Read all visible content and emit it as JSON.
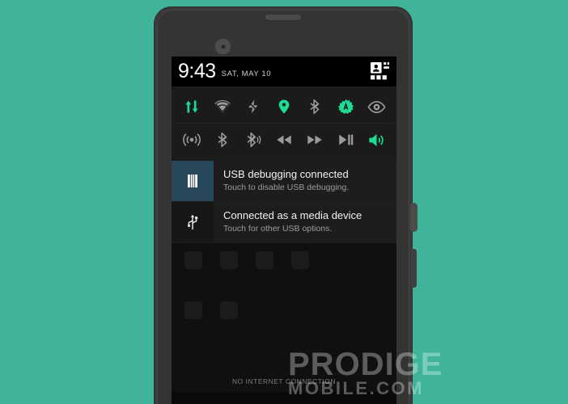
{
  "background_color": "#3fb49b",
  "device": {
    "name": "smartphone",
    "earpiece_label": "earpiece-speaker",
    "camera_label": "front-camera",
    "power_button_label": "power-button",
    "volume_button_label": "volume-rocker"
  },
  "status_bar": {
    "time": "9:43",
    "date": "SAT, MAY 10",
    "settings_icon": "quick-settings-user-icon"
  },
  "quick_settings": {
    "row1": [
      {
        "name": "data-transfer-tile",
        "icon": "data-transfer-arrows-icon",
        "state": "on",
        "color": "#1ddb92"
      },
      {
        "name": "wifi-tile",
        "icon": "wifi-icon",
        "state": "off",
        "color": "#9a9a9a"
      },
      {
        "name": "flash-tile",
        "icon": "lightning-bolt-icon",
        "state": "off",
        "color": "#9a9a9a"
      },
      {
        "name": "location-tile",
        "icon": "location-pin-icon",
        "state": "on",
        "color": "#1ddb92"
      },
      {
        "name": "bluetooth-tile",
        "icon": "bluetooth-icon",
        "state": "off",
        "color": "#9a9a9a"
      },
      {
        "name": "auto-brightness-tile",
        "icon": "auto-brightness-gear-icon",
        "state": "on",
        "color": "#1ddb92"
      },
      {
        "name": "visibility-tile",
        "icon": "eye-icon",
        "state": "off",
        "color": "#9a9a9a"
      }
    ],
    "row2": [
      {
        "name": "hotspot-tile",
        "icon": "signal-waves-icon",
        "state": "off",
        "color": "#9a9a9a"
      },
      {
        "name": "bluetooth-tile-2",
        "icon": "bluetooth-icon",
        "state": "off",
        "color": "#9a9a9a"
      },
      {
        "name": "bluetooth-audio-tile",
        "icon": "bluetooth-audio-icon",
        "state": "off",
        "color": "#9a9a9a"
      },
      {
        "name": "rewind-tile",
        "icon": "rewind-icon",
        "state": "off",
        "color": "#9a9a9a"
      },
      {
        "name": "fast-forward-tile",
        "icon": "fast-forward-icon",
        "state": "off",
        "color": "#9a9a9a"
      },
      {
        "name": "play-pause-tile",
        "icon": "play-pause-icon",
        "state": "off",
        "color": "#9a9a9a"
      },
      {
        "name": "volume-tile",
        "icon": "volume-speaker-icon",
        "state": "on",
        "color": "#1ddb92"
      }
    ]
  },
  "notifications": [
    {
      "icon": "usb-debugging-bug-icon",
      "icon_bg": "#27485a",
      "title": "USB debugging connected",
      "subtitle": "Touch to disable USB debugging."
    },
    {
      "icon": "usb-trident-icon",
      "icon_bg": "#171717",
      "title": "Connected as a media device",
      "subtitle": "Touch for other USB options."
    }
  ],
  "footer": {
    "status_text": "NO INTERNET CONNECTION"
  },
  "watermark": {
    "main": "PRODIGE",
    "sub": "MOBILE.COM"
  }
}
